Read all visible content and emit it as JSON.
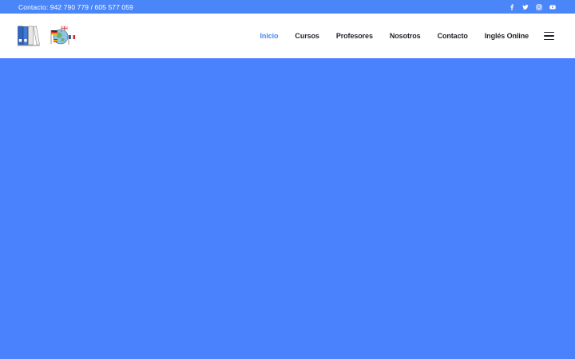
{
  "topbar": {
    "contact": "Contacto: 942 790 779 / 605 577 059",
    "socials": [
      {
        "icon": "facebook-icon"
      },
      {
        "icon": "twitter-icon"
      },
      {
        "icon": "instagram-icon"
      },
      {
        "icon": "youtube-icon"
      }
    ]
  },
  "nav": {
    "items": [
      {
        "label": "Inicio",
        "active": true
      },
      {
        "label": "Cursos"
      },
      {
        "label": "Profesores"
      },
      {
        "label": "Nosotros"
      },
      {
        "label": "Contacto"
      },
      {
        "label": "Inglés Online"
      }
    ],
    "menu_icon": "hamburger-menu-icon"
  },
  "colors": {
    "accent": "#4a86f7",
    "hero": "#4a82fd",
    "text": "#1f2229"
  }
}
